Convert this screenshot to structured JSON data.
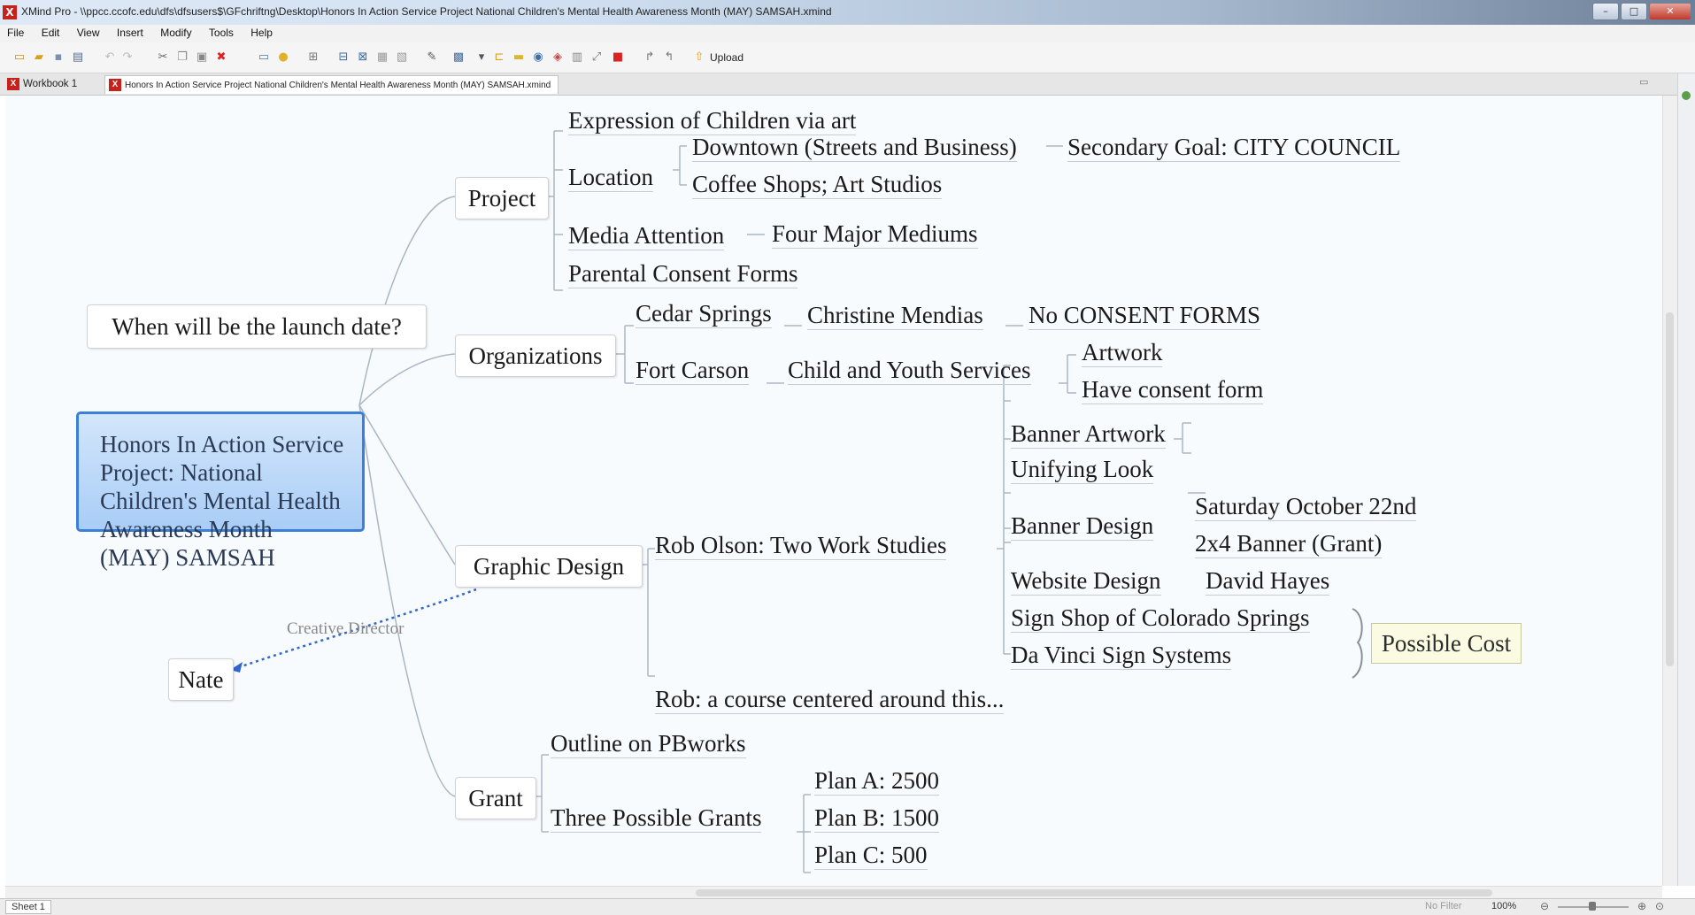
{
  "window": {
    "title": "XMind Pro - \\\\ppcc.ccofc.edu\\dfs\\dfsusers$\\GFchriftng\\Desktop\\Honors In Action Service Project  National Children's Mental Health Awareness Month (MAY) SAMSAH.xmind",
    "controls": [
      "–",
      "□",
      "✕"
    ]
  },
  "menu": [
    "File",
    "Edit",
    "View",
    "Insert",
    "Modify",
    "Tools",
    "Help"
  ],
  "toolbar": {
    "upload_label": "Upload"
  },
  "tabs": [
    {
      "label": "Workbook 1"
    },
    {
      "label": "Honors In Action Service Project  National Children's Mental Health Awareness Month (MAY) SAMSAH.xmind"
    }
  ],
  "mindmap": {
    "central": "Honors In Action Service Project: National Children's Mental Health Awareness Month (MAY) SAMSAH",
    "floating_question": "When will be the launch date?",
    "floating_person": "Nate",
    "relationship_label": "Creative Director",
    "project": {
      "label": "Project",
      "expression": "Expression of Children via art",
      "location": "Location",
      "downtown": "Downtown (Streets and Business)",
      "secondary_goal": "Secondary Goal: CITY COUNCIL",
      "coffee": "Coffee Shops; Art Studios",
      "media": "Media Attention",
      "mediums": "Four Major Mediums",
      "consent": "Parental Consent Forms"
    },
    "organizations": {
      "label": "Organizations",
      "cedar": "Cedar Springs",
      "christine": "Christine Mendias",
      "no_consent": "No CONSENT FORMS",
      "fort": "Fort Carson",
      "child_youth": "Child and Youth Services",
      "artwork": "Artwork",
      "have_consent": "Have consent form"
    },
    "graphic_design": {
      "label": "Graphic Design",
      "rob_olson": "Rob Olson: Two Work Studies",
      "banner_artwork": "Banner Artwork",
      "unifying": "Unifying Look",
      "banner_design": "Banner Design",
      "saturday": "Saturday October 22nd",
      "banner_size": "2x4 Banner (Grant)",
      "website": "Website Design",
      "david": "David Hayes",
      "sign_shop": "Sign Shop of Colorado Springs",
      "da_vinci": "Da Vinci Sign Systems",
      "possible_cost": "Possible Cost",
      "rob_course": "Rob: a course centered around this..."
    },
    "grant": {
      "label": "Grant",
      "outline": "Outline on PBworks",
      "three": "Three Possible Grants",
      "plan_a": "Plan A: 2500",
      "plan_b": "Plan B: 1500",
      "plan_c": "Plan C: 500"
    }
  },
  "status": {
    "sheet": "Sheet 1",
    "filter": "No Filter",
    "zoom": "100%"
  }
}
